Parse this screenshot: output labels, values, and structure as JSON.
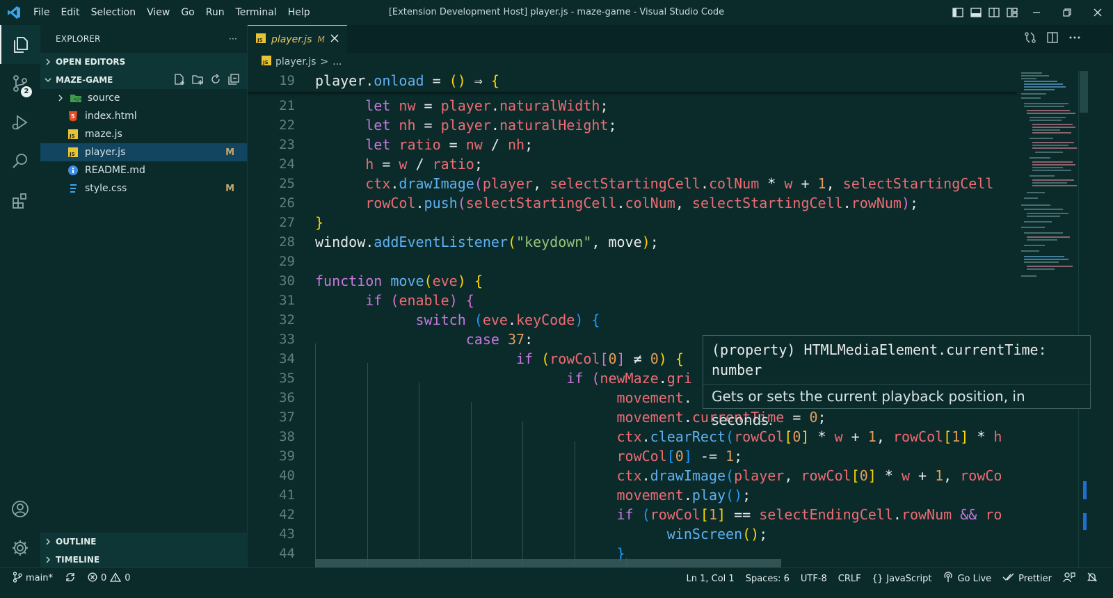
{
  "titlebar": {
    "menu": [
      "File",
      "Edit",
      "Selection",
      "View",
      "Go",
      "Run",
      "Terminal",
      "Help"
    ],
    "title": "[Extension Development Host] player.js - maze-game - Visual Studio Code"
  },
  "activity": {
    "scm_badge": "2"
  },
  "sidebar": {
    "header": "EXPLORER",
    "more": "···",
    "open_editors": "OPEN EDITORS",
    "folder": "MAZE-GAME",
    "files": [
      {
        "name": "source",
        "mark": ""
      },
      {
        "name": "index.html",
        "mark": ""
      },
      {
        "name": "maze.js",
        "mark": ""
      },
      {
        "name": "player.js",
        "mark": "M"
      },
      {
        "name": "README.md",
        "mark": ""
      },
      {
        "name": "style.css",
        "mark": "M"
      }
    ],
    "outline": "OUTLINE",
    "timeline": "TIMELINE"
  },
  "editor": {
    "tab": {
      "name": "player.js",
      "mark": "M",
      "icon": "JS"
    },
    "breadcrumb": {
      "file": "player.js",
      "sep": ">",
      "rest": "..."
    },
    "line_numbers": [
      "19",
      "21",
      "22",
      "23",
      "24",
      "25",
      "26",
      "27",
      "28",
      "29",
      "30",
      "31",
      "32",
      "33",
      "34",
      "35",
      "36",
      "37",
      "38",
      "39",
      "40",
      "41",
      "42",
      "43",
      "44"
    ]
  },
  "hover": {
    "signature_line1": "(property) HTMLMediaElement.currentTime:",
    "signature_line2": "number",
    "doc": "Gets or sets the current playback position, in seconds."
  },
  "status": {
    "branch": "main*",
    "errors": "0",
    "warnings": "0",
    "position": "Ln 1, Col 1",
    "spaces": "Spaces: 6",
    "encoding": "UTF-8",
    "eol": "CRLF",
    "language": "JavaScript",
    "golive": "Go Live",
    "prettier": "Prettier"
  },
  "colors": {
    "background": "#0b2b2b",
    "tab_border": "#d7bf3a",
    "selection": "#124560"
  }
}
